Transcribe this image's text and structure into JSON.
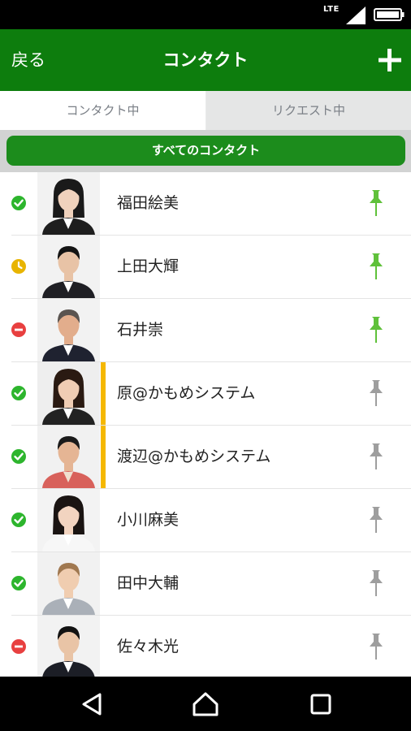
{
  "status_bar": {
    "network": "LTE"
  },
  "app_bar": {
    "back_label": "戻る",
    "title": "コンタクト"
  },
  "tabs": [
    {
      "label": "コンタクト中",
      "selected": true
    },
    {
      "label": "リクエスト中",
      "selected": false
    }
  ],
  "filter": {
    "label": "すべてのコンタクト"
  },
  "colors": {
    "header": "#0d7d0d",
    "filter_button": "#1c8c1c",
    "online": "#2db52d",
    "away": "#e8b400",
    "busy": "#e84040",
    "pin_active": "#5fc13a",
    "pin_inactive": "#9e9e9e",
    "accent": "#f5b800"
  },
  "contacts": [
    {
      "name": "福田絵美",
      "status": "online",
      "pinned": true,
      "accent": false,
      "photo": "woman-dark-hair-suit"
    },
    {
      "name": "上田大輝",
      "status": "away",
      "pinned": true,
      "accent": false,
      "photo": "man-glasses-suit"
    },
    {
      "name": "石井崇",
      "status": "busy",
      "pinned": true,
      "accent": false,
      "photo": "older-man-suit"
    },
    {
      "name": "原@かもめシステム",
      "status": "online",
      "pinned": false,
      "accent": true,
      "photo": "woman-smiling"
    },
    {
      "name": "渡辺@かもめシステム",
      "status": "online",
      "pinned": false,
      "accent": true,
      "photo": "man-red-sweater"
    },
    {
      "name": "小川麻美",
      "status": "online",
      "pinned": false,
      "accent": false,
      "photo": "woman-smiling-white"
    },
    {
      "name": "田中大輔",
      "status": "online",
      "pinned": false,
      "accent": false,
      "photo": "man-light-hair-suit"
    },
    {
      "name": "佐々木光",
      "status": "busy",
      "pinned": false,
      "accent": false,
      "photo": "man-dark-suit"
    }
  ],
  "nav": [
    {
      "icon": "back-triangle-icon"
    },
    {
      "icon": "home-icon"
    },
    {
      "icon": "recents-square-icon"
    }
  ]
}
